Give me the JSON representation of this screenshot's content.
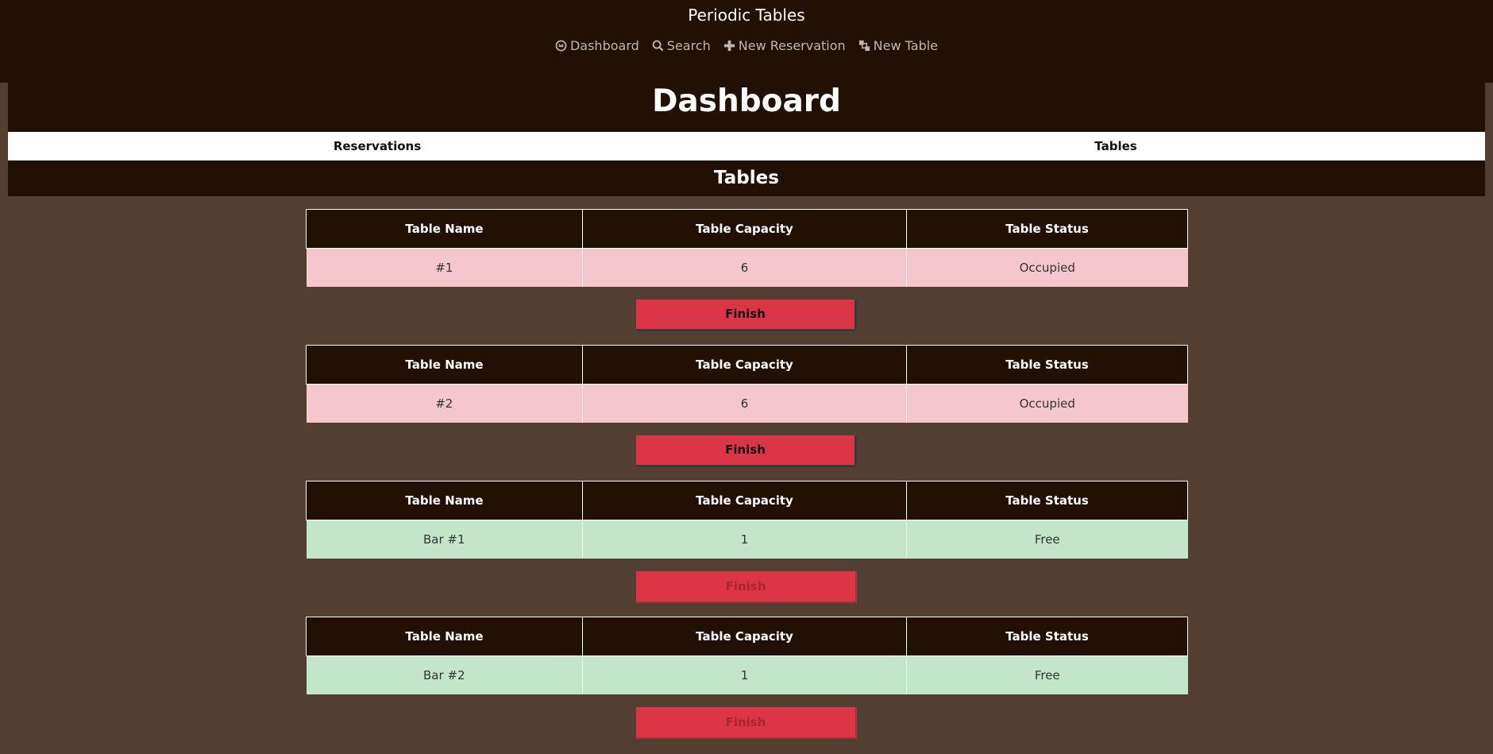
{
  "header": {
    "brand": "Periodic Tables",
    "nav": [
      {
        "label": "Dashboard",
        "icon": "dashboard-icon"
      },
      {
        "label": "Search",
        "icon": "search-icon"
      },
      {
        "label": "New Reservation",
        "icon": "plus-icon"
      },
      {
        "label": "New Table",
        "icon": "layers-icon"
      }
    ]
  },
  "page": {
    "title": "Dashboard"
  },
  "tabs": [
    "Reservations",
    "Tables"
  ],
  "section": {
    "title": "Tables"
  },
  "table_headers": {
    "name": "Table Name",
    "capacity": "Table Capacity",
    "status": "Table Status"
  },
  "tables": [
    {
      "name": "#1",
      "capacity": "6",
      "status": "Occupied",
      "finish_label": "Finish",
      "finish_enabled": true
    },
    {
      "name": "#2",
      "capacity": "6",
      "status": "Occupied",
      "finish_label": "Finish",
      "finish_enabled": true
    },
    {
      "name": "Bar #1",
      "capacity": "1",
      "status": "Free",
      "finish_label": "Finish",
      "finish_enabled": false
    },
    {
      "name": "Bar #2",
      "capacity": "1",
      "status": "Free",
      "finish_label": "Finish",
      "finish_enabled": false
    }
  ],
  "colors": {
    "header_bg": "#231005",
    "page_bg": "#523f32",
    "occupied_row": "#f5c6cb",
    "free_row": "#c3e6cb",
    "finish_button": "#dc3545"
  }
}
